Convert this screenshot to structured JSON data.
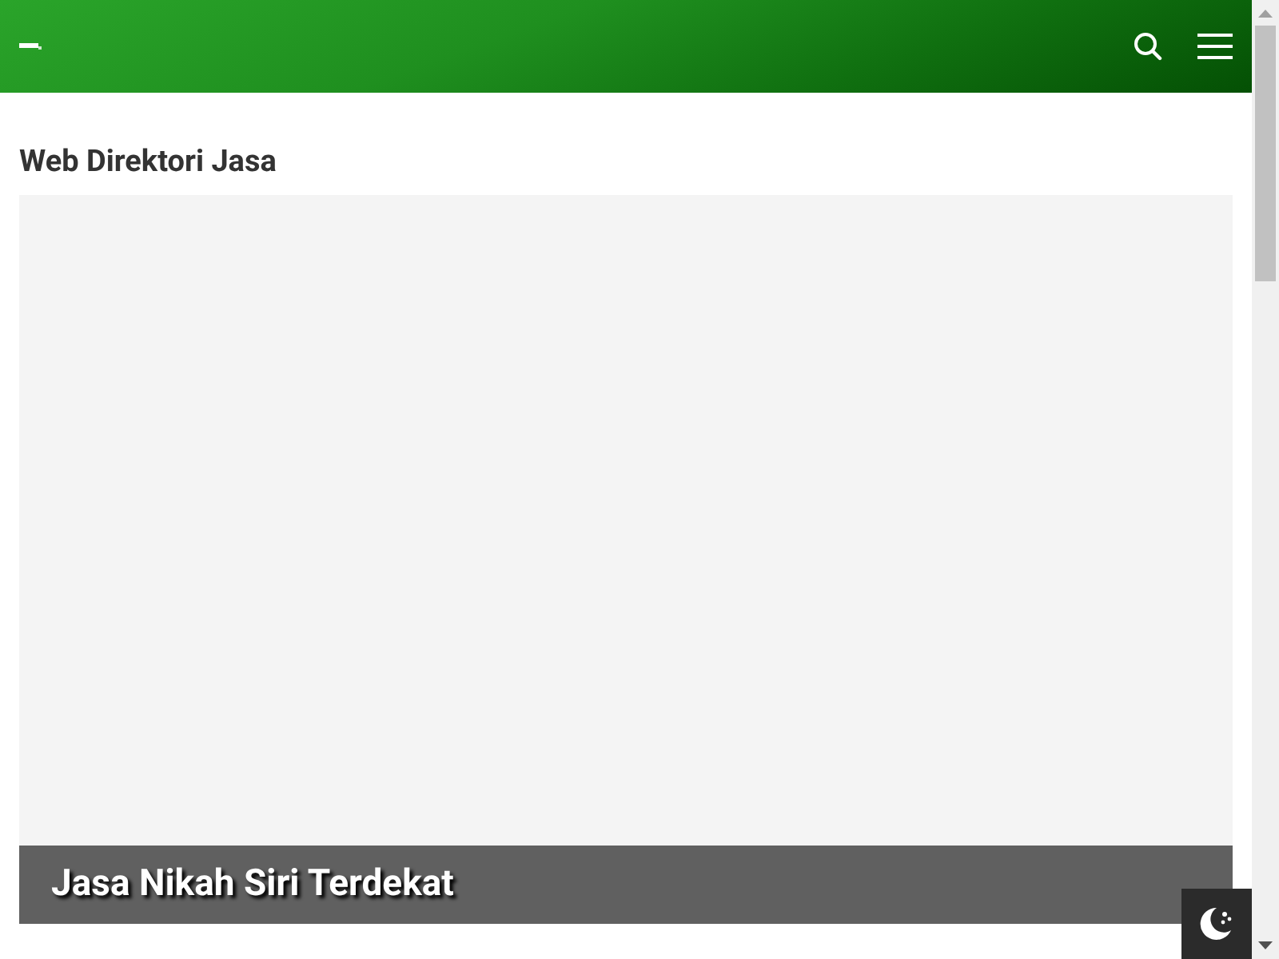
{
  "section": {
    "title": "Web Direktori Jasa"
  },
  "featured_post": {
    "title": "Jasa Nikah Siri Terdekat"
  }
}
